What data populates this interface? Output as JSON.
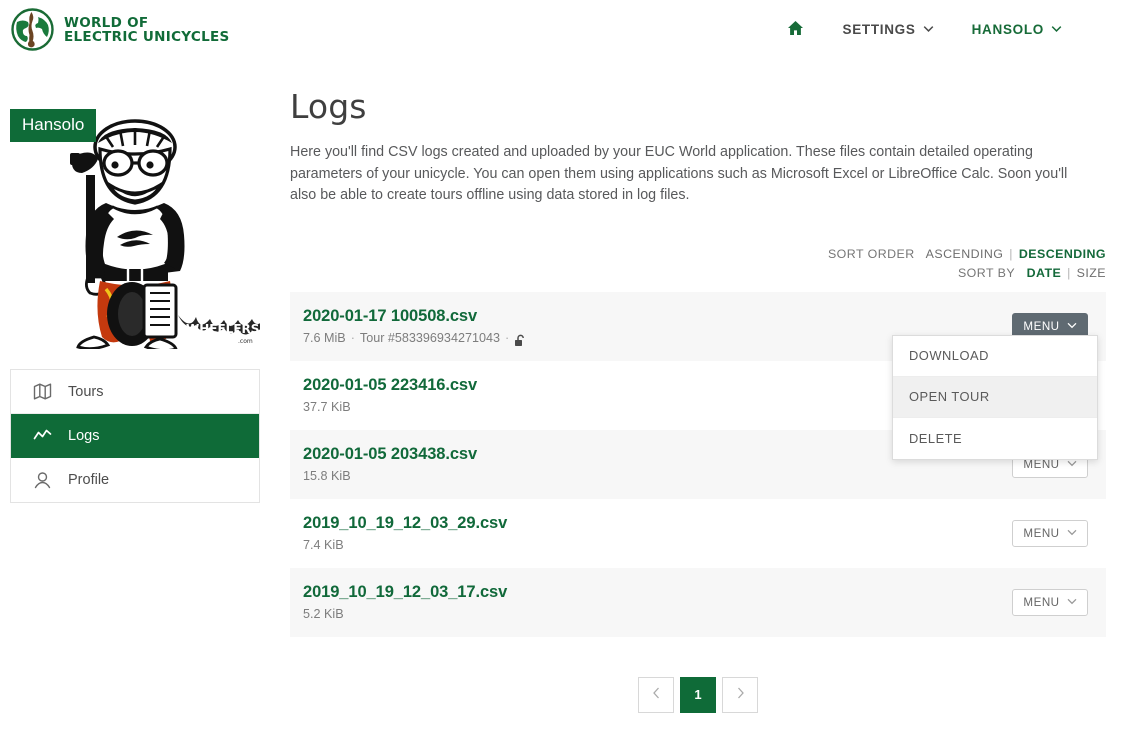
{
  "brand": {
    "line1": "World of",
    "line2": "Electric Unicycles",
    "logo_icon": "globe-unicycle-logo"
  },
  "topnav": {
    "home_icon": "home-icon",
    "items": [
      {
        "label": "SETTINGS",
        "icon": "chevron-down-icon"
      },
      {
        "label": "HANSOLO",
        "icon": "chevron-down-icon"
      }
    ]
  },
  "sidebar": {
    "username": "Hansolo",
    "avatar_icon": "unicycle-rider-avatar",
    "items": [
      {
        "label": "Tours",
        "icon": "map-icon",
        "active": false
      },
      {
        "label": "Logs",
        "icon": "chart-line-icon",
        "active": true
      },
      {
        "label": "Profile",
        "icon": "user-icon",
        "active": false
      }
    ]
  },
  "main": {
    "title": "Logs",
    "description": "Here you'll find CSV logs created and uploaded by your EUC World application. These files contain detailed operating parameters of your unicycle. You can open them using applications such as Microsoft Excel or LibreOffice Calc. Soon you'll also be able to create tours offline using data stored in log files."
  },
  "sort": {
    "order_label": "SORT ORDER",
    "order_options": [
      "ASCENDING",
      "DESCENDING"
    ],
    "order_selected": "DESCENDING",
    "by_label": "SORT BY",
    "by_options": [
      "DATE",
      "SIZE"
    ],
    "by_selected": "DATE",
    "separator": "|"
  },
  "logs": {
    "menu_button_label": "MENU",
    "menu_button_icon": "chevron-down-icon",
    "rows": [
      {
        "name": "2020-01-17 100508.csv",
        "size": "7.6 MiB",
        "tour": "Tour #583396934271043",
        "lock_icon": "unlock-icon",
        "has_tour": true,
        "menu_open": true
      },
      {
        "name": "2020-01-05 223416.csv",
        "size": "37.7 KiB",
        "tour": "",
        "lock_icon": "",
        "has_tour": false,
        "menu_open": false
      },
      {
        "name": "2020-01-05 203438.csv",
        "size": "15.8 KiB",
        "tour": "",
        "lock_icon": "",
        "has_tour": false,
        "menu_open": false
      },
      {
        "name": "2019_10_19_12_03_29.csv",
        "size": "7.4 KiB",
        "tour": "",
        "lock_icon": "",
        "has_tour": false,
        "menu_open": false
      },
      {
        "name": "2019_10_19_12_03_17.csv",
        "size": "5.2 KiB",
        "tour": "",
        "lock_icon": "",
        "has_tour": false,
        "menu_open": false
      }
    ]
  },
  "dropdown": {
    "items": [
      {
        "label": "DOWNLOAD",
        "hover": false
      },
      {
        "label": "OPEN TOUR",
        "hover": true
      },
      {
        "label": "DELETE",
        "hover": false
      }
    ]
  },
  "pagination": {
    "prev_icon": "chevron-left-icon",
    "next_icon": "chevron-right-icon",
    "pages": [
      "1"
    ],
    "current": "1"
  },
  "colors": {
    "brand_green": "#0f6b38",
    "link_green": "#11693a",
    "menu_active_gray": "#5f6a72",
    "row_alt": "#f7f7f7"
  }
}
